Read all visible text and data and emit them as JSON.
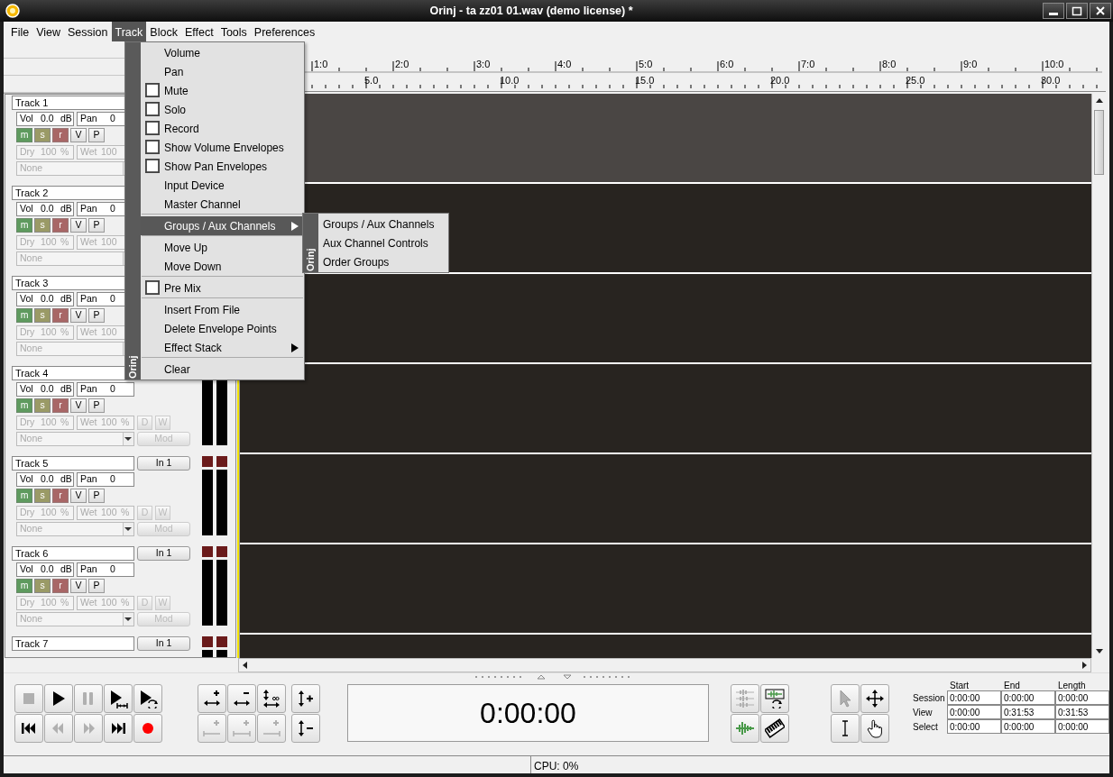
{
  "window": {
    "title": "Orinj - ta zz01 01.wav (demo license)  *"
  },
  "menu_bar": [
    {
      "label": "File",
      "selected": false
    },
    {
      "label": "View",
      "selected": false
    },
    {
      "label": "Session",
      "selected": false
    },
    {
      "label": "Track",
      "selected": true
    },
    {
      "label": "Block",
      "selected": false
    },
    {
      "label": "Effect",
      "selected": false
    },
    {
      "label": "Tools",
      "selected": false
    },
    {
      "label": "Preferences",
      "selected": false
    }
  ],
  "track_menu": {
    "side_label": "Orinj",
    "items": [
      {
        "kind": "item",
        "label": "Volume",
        "selected": false
      },
      {
        "kind": "item",
        "label": "Pan",
        "selected": false
      },
      {
        "kind": "check",
        "label": "Mute",
        "checked": false,
        "selected": false
      },
      {
        "kind": "check",
        "label": "Solo",
        "checked": false,
        "selected": false
      },
      {
        "kind": "check",
        "label": "Record",
        "checked": false,
        "selected": false
      },
      {
        "kind": "check",
        "label": "Show Volume Envelopes",
        "checked": false,
        "selected": false
      },
      {
        "kind": "check",
        "label": "Show Pan Envelopes",
        "checked": false,
        "selected": false
      },
      {
        "kind": "item",
        "label": "Input Device",
        "selected": false
      },
      {
        "kind": "item",
        "label": "Master Channel",
        "selected": false
      },
      {
        "kind": "separator"
      },
      {
        "kind": "submenu",
        "label": "Groups / Aux Channels",
        "selected": true
      },
      {
        "kind": "separator"
      },
      {
        "kind": "item",
        "label": "Move Up",
        "selected": false
      },
      {
        "kind": "item",
        "label": "Move Down",
        "selected": false
      },
      {
        "kind": "separator"
      },
      {
        "kind": "check",
        "label": "Pre Mix",
        "checked": false,
        "selected": false
      },
      {
        "kind": "separator"
      },
      {
        "kind": "item",
        "label": "Insert From File",
        "selected": false
      },
      {
        "kind": "item",
        "label": "Delete Envelope Points",
        "selected": false
      },
      {
        "kind": "submenu",
        "label": "Effect Stack",
        "selected": false
      },
      {
        "kind": "separator"
      },
      {
        "kind": "item",
        "label": "Clear",
        "selected": false
      }
    ]
  },
  "submenu": {
    "side_label": "Orinj",
    "items": [
      {
        "label": "Groups / Aux Channels",
        "selected": false
      },
      {
        "label": "Aux Channel Controls",
        "selected": false
      },
      {
        "label": "Order Groups",
        "selected": false
      }
    ]
  },
  "ruler": {
    "bars": [
      "1:0",
      "2:0",
      "3:0",
      "4:0",
      "5:0",
      "6:0",
      "7:0",
      "8:0",
      "9:0",
      "10:0"
    ],
    "seconds": [
      "5.0",
      "10.0",
      "15.0",
      "20.0",
      "25.0",
      "30.0"
    ]
  },
  "tracks": [
    {
      "name": "Track 1",
      "vol_label": "Vol",
      "vol": "0.0",
      "vol_unit": "dB",
      "pan_label": "Pan",
      "pan": "0",
      "buttons": [
        "m",
        "s",
        "r",
        "V",
        "P"
      ],
      "dry_label": "Dry",
      "dry": "100",
      "dry_unit": "%",
      "wet_label": "Wet",
      "wet": "100",
      "effect": "None",
      "effects_disabled": true
    },
    {
      "name": "Track 2",
      "vol_label": "Vol",
      "vol": "0.0",
      "vol_unit": "dB",
      "pan_label": "Pan",
      "pan": "0",
      "buttons": [
        "m",
        "s",
        "r",
        "V",
        "P"
      ],
      "dry_label": "Dry",
      "dry": "100",
      "dry_unit": "%",
      "wet_label": "Wet",
      "wet": "100",
      "effect": "None",
      "effects_disabled": true
    },
    {
      "name": "Track 3",
      "vol_label": "Vol",
      "vol": "0.0",
      "vol_unit": "dB",
      "pan_label": "Pan",
      "pan": "0",
      "buttons": [
        "m",
        "s",
        "r",
        "V",
        "P"
      ],
      "dry_label": "Dry",
      "dry": "100",
      "dry_unit": "%",
      "wet_label": "Wet",
      "wet": "100",
      "effect": "None",
      "effects_disabled": true
    },
    {
      "name": "Track 4",
      "vol_label": "Vol",
      "vol": "0.0",
      "vol_unit": "dB",
      "pan_label": "Pan",
      "pan": "0",
      "buttons": [
        "m",
        "s",
        "r",
        "V",
        "P"
      ],
      "dry_label": "Dry",
      "dry": "100",
      "dry_unit": "%",
      "wet_label": "Wet",
      "wet": "100",
      "wet_unit": "%",
      "d": "D",
      "w": "W",
      "effect": "None",
      "mod": "Mod",
      "effects_disabled": true,
      "meter": true
    },
    {
      "name": "Track 5",
      "input": "In 1",
      "vol_label": "Vol",
      "vol": "0.0",
      "vol_unit": "dB",
      "pan_label": "Pan",
      "pan": "0",
      "buttons": [
        "m",
        "s",
        "r",
        "V",
        "P"
      ],
      "dry_label": "Dry",
      "dry": "100",
      "dry_unit": "%",
      "wet_label": "Wet",
      "wet": "100",
      "wet_unit": "%",
      "d": "D",
      "w": "W",
      "effect": "None",
      "mod": "Mod",
      "effects_disabled": true,
      "meter": true
    },
    {
      "name": "Track 6",
      "input": "In 1",
      "vol_label": "Vol",
      "vol": "0.0",
      "vol_unit": "dB",
      "pan_label": "Pan",
      "pan": "0",
      "buttons": [
        "m",
        "s",
        "r",
        "V",
        "P"
      ],
      "dry_label": "Dry",
      "dry": "100",
      "dry_unit": "%",
      "wet_label": "Wet",
      "wet": "100",
      "wet_unit": "%",
      "d": "D",
      "w": "W",
      "effect": "None",
      "mod": "Mod",
      "effects_disabled": true,
      "meter": true
    },
    {
      "name": "Track 7",
      "input": "In 1",
      "meter": true
    }
  ],
  "lanes": [
    {
      "selected": true
    },
    {
      "selected": false
    },
    {
      "selected": false
    },
    {
      "selected": false
    },
    {
      "selected": false
    },
    {
      "selected": false
    },
    {
      "selected": false
    }
  ],
  "transport": [
    {
      "kind": "stop",
      "disabled": true
    },
    {
      "kind": "play",
      "disabled": false
    },
    {
      "kind": "pause",
      "disabled": true
    },
    {
      "kind": "play_range",
      "disabled": false
    },
    {
      "kind": "play_loop",
      "disabled": false
    },
    {
      "kind": "to_start",
      "disabled": false
    },
    {
      "kind": "rewind",
      "disabled": true
    },
    {
      "kind": "forward",
      "disabled": true
    },
    {
      "kind": "to_end",
      "disabled": false
    },
    {
      "kind": "record",
      "disabled": false
    }
  ],
  "zoom": [
    {
      "kind": "zoom_in",
      "disabled": false
    },
    {
      "kind": "zoom_out",
      "disabled": false
    },
    {
      "kind": "zoom_fit",
      "disabled": false
    },
    {
      "kind": "zoom_in_sel",
      "disabled": true
    },
    {
      "kind": "zoom_range",
      "disabled": true
    },
    {
      "kind": "zoom_end",
      "disabled": true
    }
  ],
  "vzoom": [
    {
      "kind": "vzoom_in",
      "disabled": false
    },
    {
      "kind": "vzoom_out",
      "disabled": false
    }
  ],
  "time_display": "0:00:00",
  "views": [
    {
      "kind": "multi_wave",
      "disabled": true
    },
    {
      "kind": "loop_wave",
      "disabled": false
    },
    {
      "kind": "wave",
      "disabled": false
    },
    {
      "kind": "keyboard",
      "disabled": false
    }
  ],
  "tools": [
    {
      "kind": "pointer",
      "disabled": true
    },
    {
      "kind": "move",
      "disabled": false
    },
    {
      "kind": "ibeam",
      "disabled": false
    },
    {
      "kind": "hand",
      "disabled": false
    }
  ],
  "selection_table": {
    "columns": [
      "Start",
      "End",
      "Length"
    ],
    "rows": [
      {
        "label": "Session",
        "values": [
          "0:00:00",
          "0:00:00",
          "0:00:00"
        ]
      },
      {
        "label": "View",
        "values": [
          "0:00:00",
          "0:31:53",
          "0:31:53"
        ]
      },
      {
        "label": "Select",
        "values": [
          "0:00:00",
          "0:00:00",
          "0:00:00"
        ]
      }
    ]
  },
  "status_bar": {
    "cpu": "CPU: 0%"
  }
}
